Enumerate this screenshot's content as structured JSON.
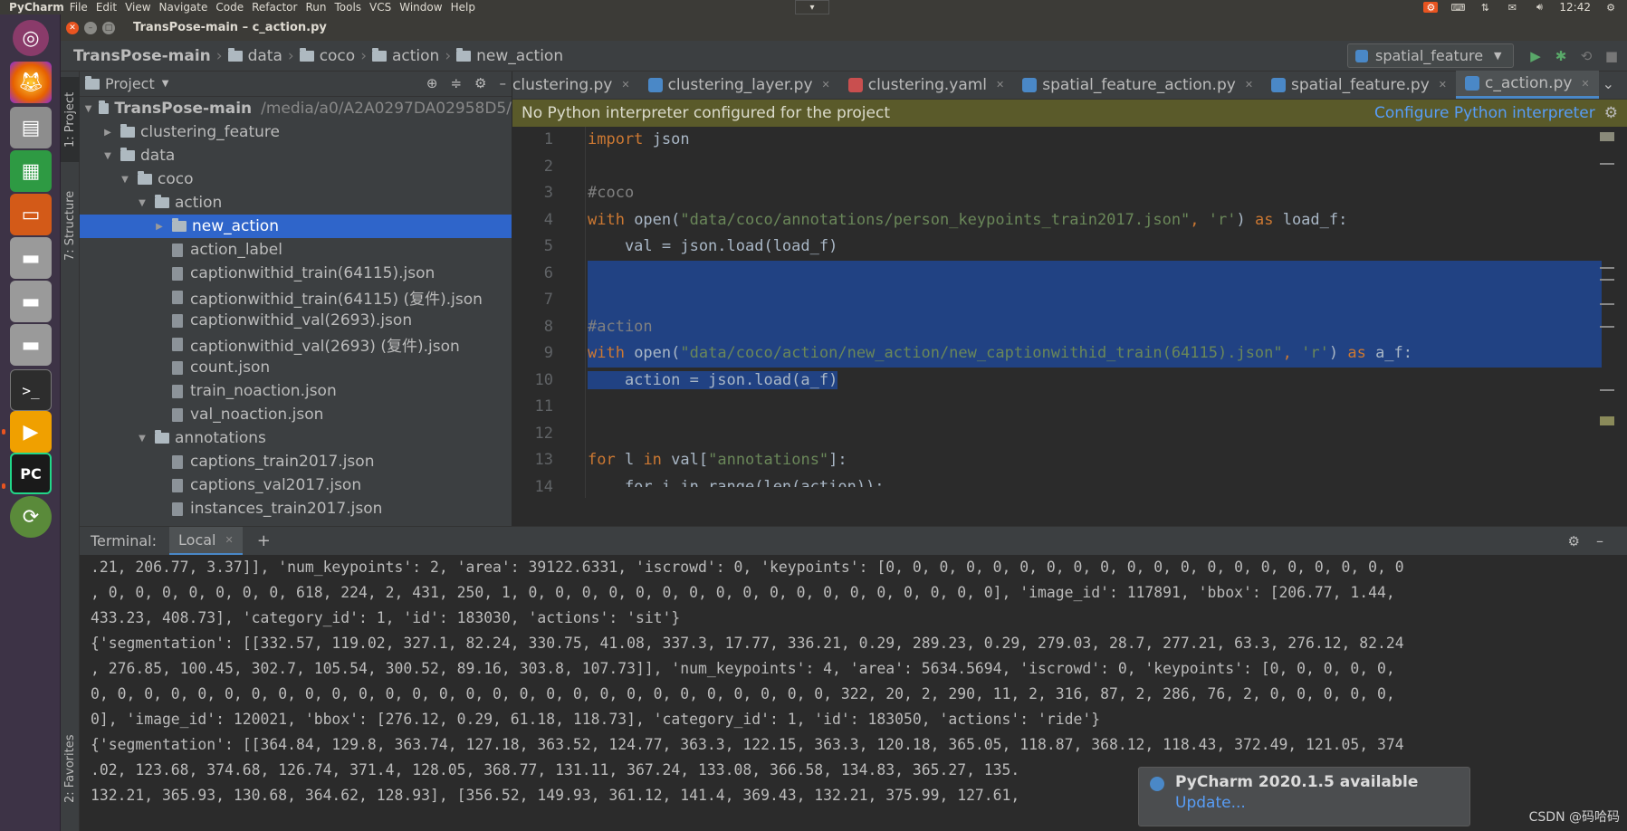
{
  "topbar": {
    "app": "PyCharm",
    "menu": [
      "File",
      "Edit",
      "View",
      "Navigate",
      "Code",
      "Refactor",
      "Run",
      "Tools",
      "VCS",
      "Window",
      "Help"
    ],
    "time": "12:42"
  },
  "window": {
    "title": "TransPose-main – c_action.py"
  },
  "breadcrumb": [
    "TransPose-main",
    "data",
    "coco",
    "action",
    "new_action"
  ],
  "run_config": "spatial_feature",
  "sidebar_tabs": {
    "project": "1: Project",
    "structure": "7: Structure",
    "favorites": "2: Favorites"
  },
  "project": {
    "header": "Project",
    "tree": [
      {
        "label": "TransPose-main",
        "extra": "/media/a0/A2A0297DA02958D5/",
        "type": "folder",
        "open": true,
        "indent": 0,
        "bold": true
      },
      {
        "label": "clustering_feature",
        "type": "folder",
        "open": false,
        "indent": 1
      },
      {
        "label": "data",
        "type": "folder",
        "open": true,
        "indent": 1
      },
      {
        "label": "coco",
        "type": "folder",
        "open": true,
        "indent": 2
      },
      {
        "label": "action",
        "type": "folder",
        "open": true,
        "indent": 3
      },
      {
        "label": "new_action",
        "type": "folder",
        "open": false,
        "indent": 4,
        "selected": true
      },
      {
        "label": "action_label",
        "type": "file",
        "indent": 4
      },
      {
        "label": "captionwithid_train(64115).json",
        "type": "file",
        "indent": 4
      },
      {
        "label": "captionwithid_train(64115) (复件).json",
        "type": "file",
        "indent": 4
      },
      {
        "label": "captionwithid_val(2693).json",
        "type": "file",
        "indent": 4
      },
      {
        "label": "captionwithid_val(2693) (复件).json",
        "type": "file",
        "indent": 4
      },
      {
        "label": "count.json",
        "type": "file",
        "indent": 4
      },
      {
        "label": "train_noaction.json",
        "type": "file",
        "indent": 4
      },
      {
        "label": "val_noaction.json",
        "type": "file",
        "indent": 4
      },
      {
        "label": "annotations",
        "type": "folder",
        "open": true,
        "indent": 3
      },
      {
        "label": "captions_train2017.json",
        "type": "file",
        "indent": 4
      },
      {
        "label": "captions_val2017.json",
        "type": "file",
        "indent": 4
      },
      {
        "label": "instances_train2017.json",
        "type": "file",
        "indent": 4
      }
    ]
  },
  "tabs": [
    {
      "label": "clustering.py",
      "icon": "python"
    },
    {
      "label": "clustering_layer.py",
      "icon": "python"
    },
    {
      "label": "clustering.yaml",
      "icon": "yaml"
    },
    {
      "label": "spatial_feature_action.py",
      "icon": "python"
    },
    {
      "label": "spatial_feature.py",
      "icon": "python"
    },
    {
      "label": "c_action.py",
      "icon": "python",
      "active": true
    }
  ],
  "warning": {
    "text": "No Python interpreter configured for the project",
    "link": "Configure Python interpreter"
  },
  "line_numbers": [
    "1",
    "2",
    "3",
    "4",
    "5",
    "6",
    "7",
    "8",
    "9",
    "10",
    "11",
    "12",
    "13",
    "14"
  ],
  "code": {
    "l1_kw": "import",
    "l1_rest": " json",
    "l3": "#coco",
    "l4_kw": "with",
    "l4_a": " open(",
    "l4_str": "\"data/coco/annotations/person_keypoints_train2017.json\"",
    "l4_b": ", ",
    "l4_str2": "'r'",
    "l4_c": ") ",
    "l4_kw2": "as",
    "l4_d": " load_f:",
    "l5": "    val = json.load(load_f)",
    "l8": "#action",
    "l9_kw": "with",
    "l9_a": " open(",
    "l9_str": "\"data/coco/action/new_action/new_captionwithid_train(64115).json\"",
    "l9_b": ", ",
    "l9_str2": "'r'",
    "l9_c": ") ",
    "l9_kw2": "as",
    "l9_d": " a_f:",
    "l10": "    action = json.load(a_f)",
    "l13_kw": "for",
    "l13_a": " l ",
    "l13_kw2": "in",
    "l13_b": " val[",
    "l13_str": "\"annotations\"",
    "l13_c": "]:",
    "l14": "    for i in range(len(action)):"
  },
  "terminal": {
    "label": "Terminal:",
    "tab": "Local",
    "lines": [
      ".21, 206.77, 3.37]], 'num_keypoints': 2, 'area': 39122.6331, 'iscrowd': 0, 'keypoints': [0, 0, 0, 0, 0, 0, 0, 0, 0, 0, 0, 0, 0, 0, 0, 0, 0, 0, 0, 0",
      ", 0, 0, 0, 0, 0, 0, 0, 618, 224, 2, 431, 250, 1, 0, 0, 0, 0, 0, 0, 0, 0, 0, 0, 0, 0, 0, 0, 0, 0, 0, 0], 'image_id': 117891, 'bbox': [206.77, 1.44,",
      "433.23, 408.73], 'category_id': 1, 'id': 183030, 'actions': 'sit'}",
      "{'segmentation': [[332.57, 119.02, 327.1, 82.24, 330.75, 41.08, 337.3, 17.77, 336.21, 0.29, 289.23, 0.29, 279.03, 28.7, 277.21, 63.3, 276.12, 82.24",
      ", 276.85, 100.45, 302.7, 105.54, 300.52, 89.16, 303.8, 107.73]], 'num_keypoints': 4, 'area': 5634.5694, 'iscrowd': 0, 'keypoints': [0, 0, 0, 0, 0,",
      "0, 0, 0, 0, 0, 0, 0, 0, 0, 0, 0, 0, 0, 0, 0, 0, 0, 0, 0, 0, 0, 0, 0, 0, 0, 0, 0, 0, 322, 20, 2, 290, 11, 2, 316, 87, 2, 286, 76, 2, 0, 0, 0, 0, 0,",
      "0], 'image_id': 120021, 'bbox': [276.12, 0.29, 61.18, 118.73], 'category_id': 1, 'id': 183050, 'actions': 'ride'}",
      "{'segmentation': [[364.84, 129.8, 363.74, 127.18, 363.52, 124.77, 363.3, 122.15, 363.3, 120.18, 365.05, 118.87, 368.12, 118.43, 372.49, 121.05, 374",
      ".02, 123.68, 374.68, 126.74, 371.4, 128.05, 368.77, 131.11, 367.24, 133.08, 366.58, 134.83, 365.27, 135.",
      "132.21, 365.93, 130.68, 364.62, 128.93], [356.52, 149.93, 361.12, 141.4, 369.43, 132.21, 375.99, 127.61,"
    ]
  },
  "notification": {
    "title": "PyCharm 2020.1.5 available",
    "link": "Update..."
  },
  "watermark": "CSDN @码哈码"
}
